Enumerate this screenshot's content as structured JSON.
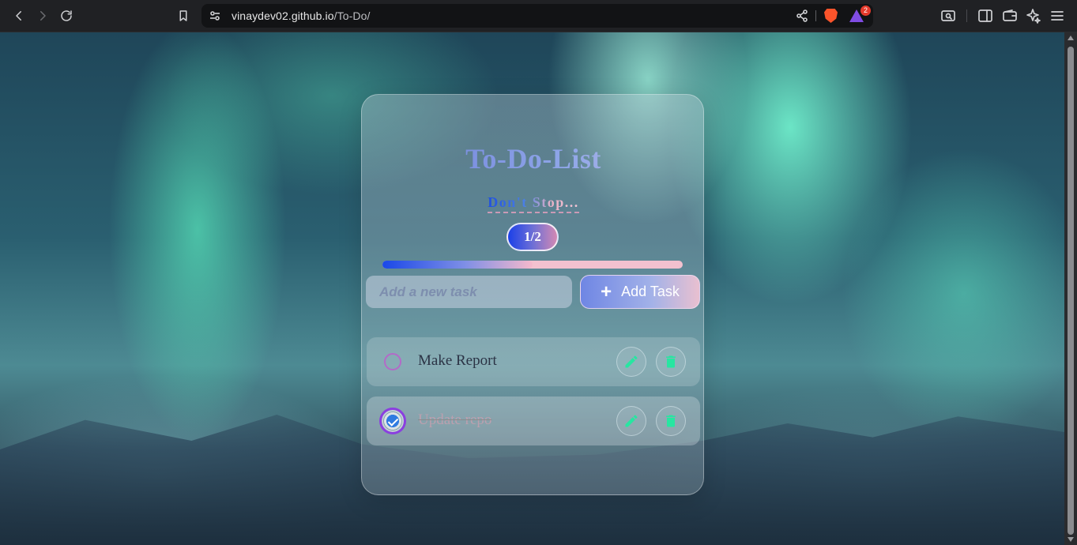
{
  "browser": {
    "url_host": "vinaydev02.github.io",
    "url_path": "/To-Do/",
    "notification_count": "2"
  },
  "app": {
    "title": "To-Do-List",
    "subtitle": "Don't Stop...",
    "counter": "1/2",
    "progress": 0.5,
    "input_placeholder": "Add a new task",
    "add_button_label": "Add Task",
    "tasks": [
      {
        "text": "Make Report",
        "completed": false
      },
      {
        "text": "Update repo",
        "completed": true
      }
    ]
  },
  "colors": {
    "accent_green": "#27e6a1",
    "accent_blue": "#1b40e8",
    "accent_purple": "#8b3fe0",
    "accent_pink": "#f3c1cf"
  }
}
